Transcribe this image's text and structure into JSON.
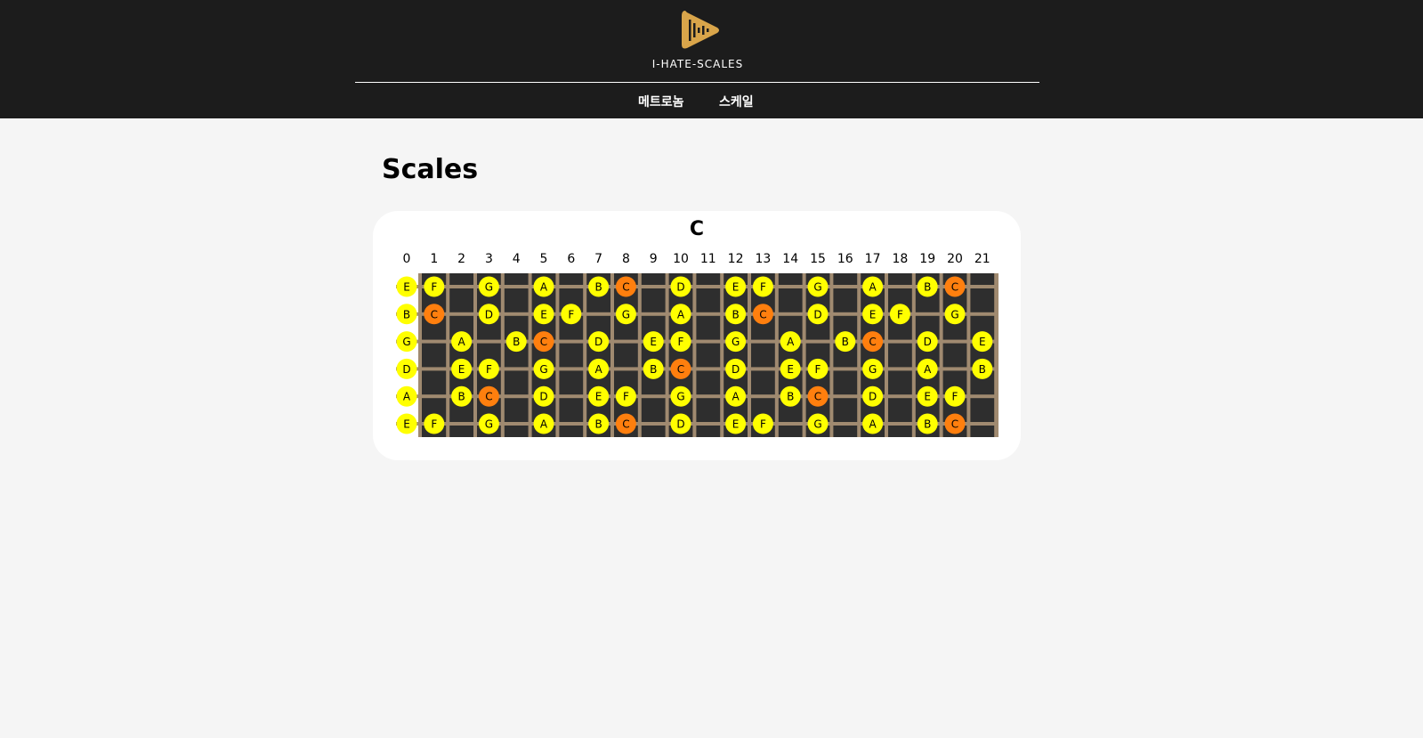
{
  "header": {
    "brand": "I-HATE-SCALES",
    "logo_icon": "play-waveform-icon",
    "nav": [
      "메트로놈",
      "스케일"
    ]
  },
  "page": {
    "title": "Scales"
  },
  "scale": {
    "name": "C"
  },
  "fretboard": {
    "frets": [
      0,
      1,
      2,
      3,
      4,
      5,
      6,
      7,
      8,
      9,
      10,
      11,
      12,
      13,
      14,
      15,
      16,
      17,
      18,
      19,
      20,
      21
    ],
    "strings": [
      {
        "open": "E",
        "notes": [
          [
            0,
            "E"
          ],
          [
            1,
            "F"
          ],
          [
            3,
            "G"
          ],
          [
            5,
            "A"
          ],
          [
            7,
            "B"
          ],
          [
            8,
            "C"
          ],
          [
            10,
            "D"
          ],
          [
            12,
            "E"
          ],
          [
            13,
            "F"
          ],
          [
            15,
            "G"
          ],
          [
            17,
            "A"
          ],
          [
            19,
            "B"
          ],
          [
            20,
            "C"
          ]
        ]
      },
      {
        "open": "B",
        "notes": [
          [
            0,
            "B"
          ],
          [
            1,
            "C"
          ],
          [
            3,
            "D"
          ],
          [
            5,
            "E"
          ],
          [
            6,
            "F"
          ],
          [
            8,
            "G"
          ],
          [
            10,
            "A"
          ],
          [
            12,
            "B"
          ],
          [
            13,
            "C"
          ],
          [
            15,
            "D"
          ],
          [
            17,
            "E"
          ],
          [
            18,
            "F"
          ],
          [
            20,
            "G"
          ]
        ]
      },
      {
        "open": "G",
        "notes": [
          [
            0,
            "G"
          ],
          [
            2,
            "A"
          ],
          [
            4,
            "B"
          ],
          [
            5,
            "C"
          ],
          [
            7,
            "D"
          ],
          [
            9,
            "E"
          ],
          [
            10,
            "F"
          ],
          [
            12,
            "G"
          ],
          [
            14,
            "A"
          ],
          [
            16,
            "B"
          ],
          [
            17,
            "C"
          ],
          [
            19,
            "D"
          ],
          [
            21,
            "E"
          ]
        ]
      },
      {
        "open": "D",
        "notes": [
          [
            0,
            "D"
          ],
          [
            2,
            "E"
          ],
          [
            3,
            "F"
          ],
          [
            5,
            "G"
          ],
          [
            7,
            "A"
          ],
          [
            9,
            "B"
          ],
          [
            10,
            "C"
          ],
          [
            12,
            "D"
          ],
          [
            14,
            "E"
          ],
          [
            15,
            "F"
          ],
          [
            17,
            "G"
          ],
          [
            19,
            "A"
          ],
          [
            21,
            "B"
          ]
        ]
      },
      {
        "open": "A",
        "notes": [
          [
            0,
            "A"
          ],
          [
            2,
            "B"
          ],
          [
            3,
            "C"
          ],
          [
            5,
            "D"
          ],
          [
            7,
            "E"
          ],
          [
            8,
            "F"
          ],
          [
            10,
            "G"
          ],
          [
            12,
            "A"
          ],
          [
            14,
            "B"
          ],
          [
            15,
            "C"
          ],
          [
            17,
            "D"
          ],
          [
            19,
            "E"
          ],
          [
            20,
            "F"
          ]
        ]
      },
      {
        "open": "E",
        "notes": [
          [
            0,
            "E"
          ],
          [
            1,
            "F"
          ],
          [
            3,
            "G"
          ],
          [
            5,
            "A"
          ],
          [
            7,
            "B"
          ],
          [
            8,
            "C"
          ],
          [
            10,
            "D"
          ],
          [
            12,
            "E"
          ],
          [
            13,
            "F"
          ],
          [
            15,
            "G"
          ],
          [
            17,
            "A"
          ],
          [
            19,
            "B"
          ],
          [
            20,
            "C"
          ]
        ]
      }
    ]
  },
  "colors": {
    "header_bg": "#1c1c1c",
    "board": "#2e2e2e",
    "fret_wire": "#a08a70",
    "string": "#a08a70",
    "note": "#ffff00",
    "root_note": "#ff7f0e",
    "logo": "#d9a54a"
  }
}
